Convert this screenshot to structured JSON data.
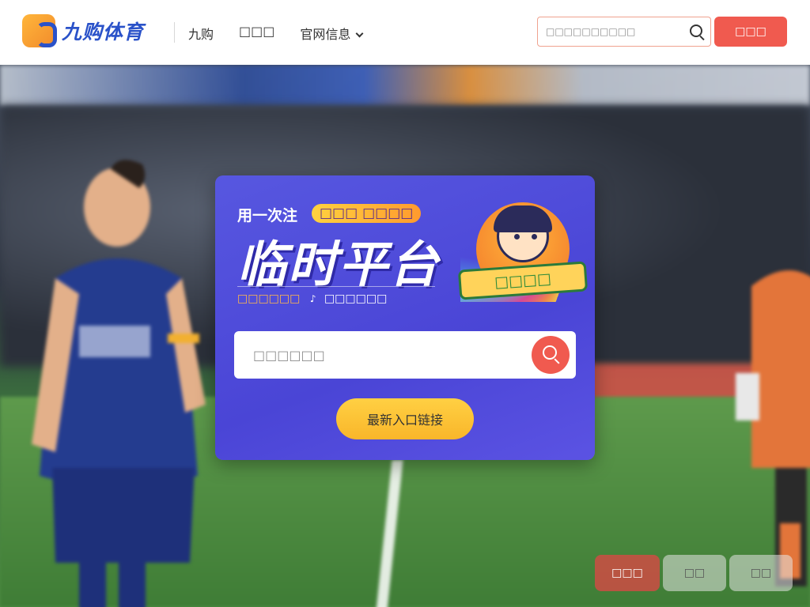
{
  "brand": {
    "name": "九购体育",
    "accent": "#2a52c9",
    "logo_color": "#f7a23a"
  },
  "header": {
    "nav": [
      {
        "label": "九购"
      },
      {
        "label": "□□□"
      },
      {
        "label": "官网信息"
      }
    ],
    "search": {
      "placeholder": "□□□□□□□□□□"
    },
    "register_label": "□□□",
    "register_color": "#f05a4f"
  },
  "promo": {
    "lead": "用一次注",
    "badge": "□□□ □□□□",
    "headline": "临时平台",
    "sub_highlight": "□□□□□□",
    "sub_note": "♪",
    "sub_text": "□□□□□□",
    "mascot_banner": "□□□□",
    "search_placeholder": "□□□□□□",
    "cta_label": "最新入口链接",
    "card_color": "#4a45d6",
    "cta_color": "#fbbf2f"
  },
  "floating": {
    "button_a": "□□□",
    "button_b": "□□",
    "button_c": "□□"
  }
}
